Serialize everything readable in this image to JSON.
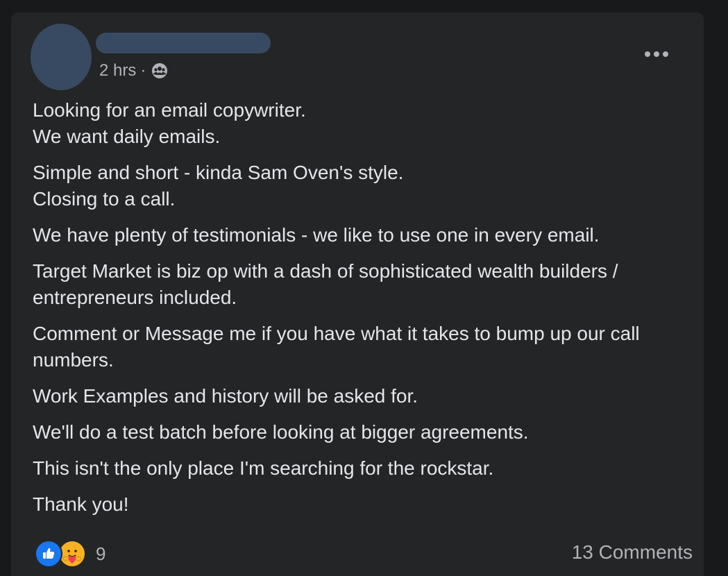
{
  "post": {
    "timestamp": "2 hrs",
    "separator": "·",
    "audience_icon": "group-audience-icon",
    "more_icon": "more-options-icon",
    "paragraphs": [
      [
        "Looking for an email copywriter.",
        "We want daily emails."
      ],
      [
        "Simple and short - kinda Sam Oven's style.",
        "Closing to a call."
      ],
      [
        "We have plenty of testimonials - we like to use one in every email."
      ],
      [
        "Target Market is biz op with a dash of sophisticated wealth builders / entrepreneurs included."
      ],
      [
        "Comment or Message me if you have what it takes to bump up our call numbers."
      ],
      [
        "Work Examples and history will be asked for."
      ],
      [
        "We'll do a test batch before looking at bigger agreements."
      ],
      [
        "This isn't the only place I'm searching for the rockstar."
      ],
      [
        "Thank you!"
      ]
    ]
  },
  "footer": {
    "reaction_icons": [
      "like-reaction-icon",
      "care-reaction-icon"
    ],
    "reaction_count": "9",
    "comments_label": "13 Comments"
  },
  "colors": {
    "page_background": "#18191a",
    "card_background": "#242526",
    "primary_text": "#e4e6eb",
    "secondary_text": "#b0b3b8",
    "redaction": "#384a62",
    "like_blue": "#1877f2",
    "care_yellow": "#f7b125"
  }
}
